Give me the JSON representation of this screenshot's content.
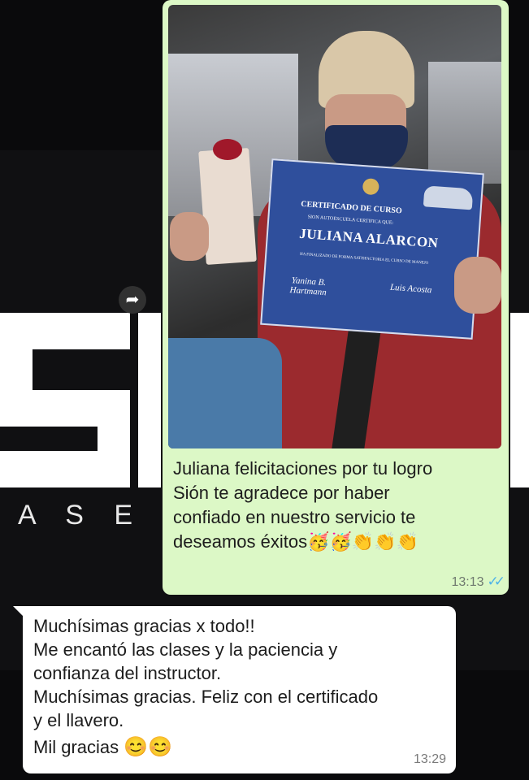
{
  "background": {
    "logo_partial_text": "SI",
    "tagline_partial_text": "A S E S"
  },
  "outgoing_message": {
    "photo": {
      "certificate": {
        "heading": "CERTIFICADO DE CURSO",
        "subheading": "SION AUTOESCUELA CERTIFICA QUE:",
        "name": "JULIANA ALARCON",
        "body": "HA FINALIZADO DE FORMA SATISFACTORIA EL CURSO DE MANEJO",
        "signature_left": "Yanina B. Hartmann",
        "signature_right": "Luis Acosta"
      }
    },
    "caption_lines": [
      "Juliana felicitaciones por tu logro",
      "Sión te agradece por haber",
      "confiado en nuestro servicio te",
      "deseamos éxitos"
    ],
    "caption_emojis": "🥳🥳👏👏👏",
    "time": "13:13",
    "status_ticks": "✓✓"
  },
  "incoming_message": {
    "lines": [
      "Muchísimas gracias x todo!!",
      "Me encantó las clases y la paciencia y",
      "confianza del instructor.",
      "Muchísimas gracias. Feliz con el certificado",
      "y el llavero.",
      "Mil gracias"
    ],
    "emojis": "😊😊",
    "time": "13:29"
  },
  "icons": {
    "forward": "forward-arrow-icon"
  },
  "colors": {
    "outgoing_bubble": "#dcf8c6",
    "incoming_bubble": "#ffffff",
    "read_ticks": "#4fb3e8",
    "background": "#0a0a0c"
  }
}
